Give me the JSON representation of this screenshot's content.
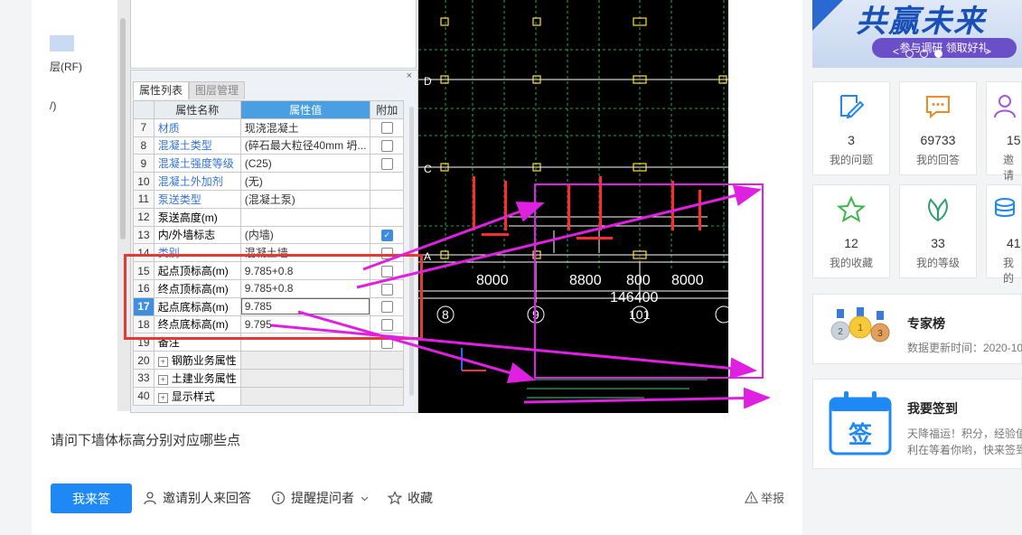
{
  "tree": {
    "rf_label": "层(RF)",
    "p_label": "/)"
  },
  "prop_panel": {
    "close": "×",
    "tabs": [
      "属性列表",
      "图层管理"
    ],
    "headers": {
      "name": "属性名称",
      "value": "属性值",
      "attach": "附加"
    },
    "rows": [
      {
        "no": "7",
        "name": "材质",
        "value": "现浇混凝土",
        "link": true,
        "check": "off"
      },
      {
        "no": "8",
        "name": "混凝土类型",
        "value": "(碎石最大粒径40mm 坍...",
        "link": true,
        "check": "off"
      },
      {
        "no": "9",
        "name": "混凝土强度等级",
        "value": "(C25)",
        "link": true,
        "check": "off"
      },
      {
        "no": "10",
        "name": "混凝土外加剂",
        "value": "(无)",
        "link": true,
        "check": "none"
      },
      {
        "no": "11",
        "name": "泵送类型",
        "value": "(混凝土泵)",
        "link": true,
        "check": "none"
      },
      {
        "no": "12",
        "name": "泵送高度(m)",
        "value": "",
        "link": false,
        "check": "none"
      },
      {
        "no": "13",
        "name": "内/外墙标志",
        "value": "(内墙)",
        "link": false,
        "check": "on"
      },
      {
        "no": "14",
        "name": "类别",
        "value": "混凝土墙",
        "link": true,
        "check": "off"
      },
      {
        "no": "15",
        "name": "起点顶标高(m)",
        "value": "9.785+0.8",
        "link": false,
        "check": "off"
      },
      {
        "no": "16",
        "name": "终点顶标高(m)",
        "value": "9.785+0.8",
        "link": false,
        "check": "off"
      },
      {
        "no": "17",
        "name": "起点底标高(m)",
        "value": "9.785",
        "link": false,
        "check": "off",
        "selected": true
      },
      {
        "no": "18",
        "name": "终点底标高(m)",
        "value": "9.795",
        "link": false,
        "check": "off"
      },
      {
        "no": "19",
        "name": "备注",
        "value": "",
        "link": false,
        "check": "off"
      },
      {
        "no": "20",
        "name": "钢筋业务属性",
        "value": "",
        "link": false,
        "check": "none",
        "group": true
      },
      {
        "no": "33",
        "name": "土建业务属性",
        "value": "",
        "link": false,
        "check": "none",
        "group": true
      },
      {
        "no": "40",
        "name": "显示样式",
        "value": "",
        "link": false,
        "check": "none",
        "group": true
      }
    ]
  },
  "cad": {
    "grid_labels": [
      "D",
      "C",
      "A"
    ],
    "dims": [
      "8000",
      "8800",
      "800",
      "8000"
    ],
    "total": "146400",
    "axis_nums": [
      "8",
      "9",
      "101"
    ],
    "colors": {
      "bg": "#000000",
      "line": "#ffffff",
      "grid": "#2fd36b",
      "red": "#ff2b2b",
      "yellow": "#ffe033"
    }
  },
  "question": {
    "text": "请问下墙体标高分别对应哪些点"
  },
  "actions": {
    "answer": "我来答",
    "invite": "邀请别人来回答",
    "remind": "提醒提问者",
    "collect": "收藏",
    "report": "举报"
  },
  "banner": {
    "title": "共赢未来",
    "sub": "参与调研 领取好礼",
    "prev": "<",
    "next": ">"
  },
  "stats": [
    {
      "num": "3",
      "label": "我的问题",
      "icon": "edit-icon"
    },
    {
      "num": "69733",
      "label": "我的回答",
      "icon": "chat-icon"
    },
    {
      "num": "15",
      "label": "邀请",
      "icon": "user-icon"
    },
    {
      "num": "12",
      "label": "我的收藏",
      "icon": "star-icon"
    },
    {
      "num": "33",
      "label": "我的等级",
      "icon": "leaf-icon"
    },
    {
      "num": "41",
      "label": "我的",
      "icon": "coins-icon"
    }
  ],
  "expert": {
    "title": "专家榜",
    "desc": "数据更新时间：2020-10",
    "medals": [
      "2",
      "1",
      "3"
    ]
  },
  "signin": {
    "title": "我要签到",
    "desc1": "天降福运！积分，经验值",
    "desc2": "利在等着你哟，快来签到",
    "icon_text": "签"
  },
  "theme": {
    "primary": "#1e88f5",
    "red": "#e53935",
    "magenta": "#e020e0",
    "link": "#3574d4"
  }
}
